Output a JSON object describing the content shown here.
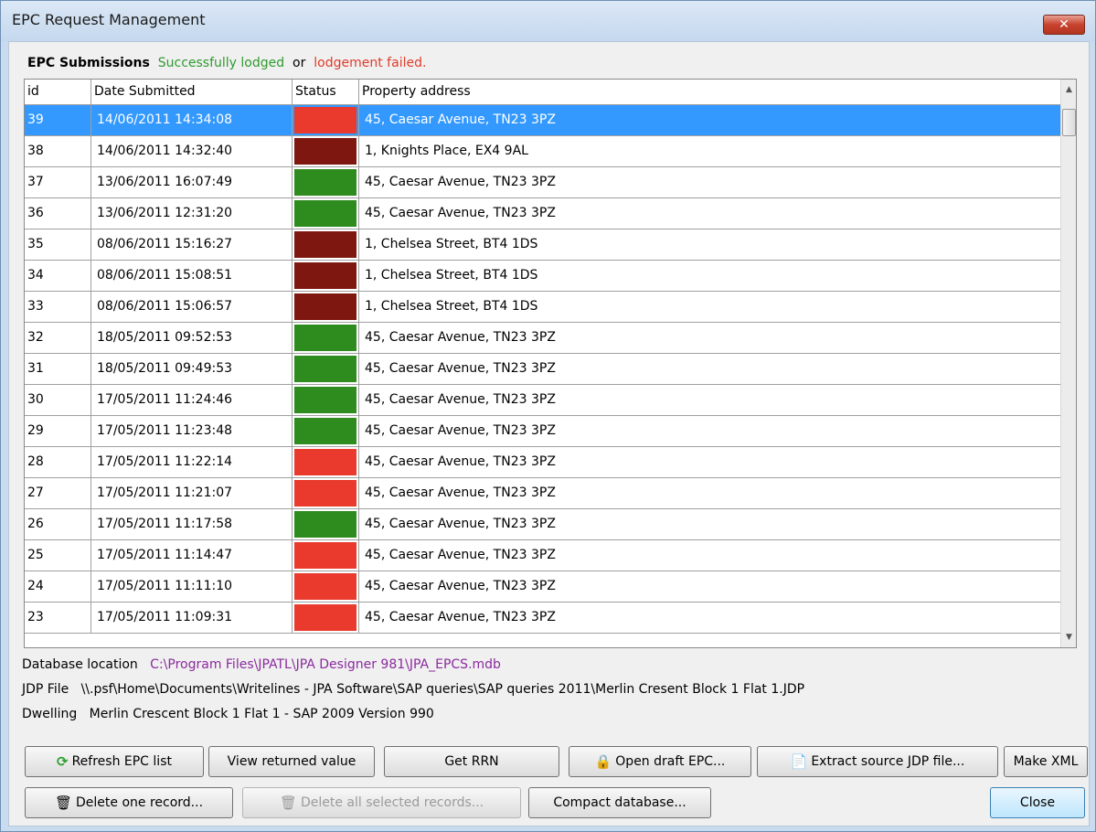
{
  "window": {
    "title": "EPC Request Management",
    "close_glyph": "✕"
  },
  "legend": {
    "prefix": "EPC Submissions",
    "ok_text": "Successfully lodged",
    "or_text": "or",
    "fail_text": "lodgement failed."
  },
  "table": {
    "columns": [
      "id",
      "Date Submitted",
      "Status",
      "Property address"
    ],
    "status_colors": {
      "red": "#ea3a2d",
      "dark_red": "#7e1710",
      "green": "#2e8b1e"
    },
    "rows": [
      {
        "id": "39",
        "date": "14/06/2011 14:34:08",
        "status": "red",
        "address": "45, Caesar Avenue, TN23 3PZ",
        "selected": true
      },
      {
        "id": "38",
        "date": "14/06/2011 14:32:40",
        "status": "dark_red",
        "address": "1, Knights Place, EX4 9AL"
      },
      {
        "id": "37",
        "date": "13/06/2011 16:07:49",
        "status": "green",
        "address": "45, Caesar Avenue, TN23 3PZ"
      },
      {
        "id": "36",
        "date": "13/06/2011 12:31:20",
        "status": "green",
        "address": "45, Caesar Avenue, TN23 3PZ"
      },
      {
        "id": "35",
        "date": "08/06/2011 15:16:27",
        "status": "dark_red",
        "address": "1, Chelsea Street, BT4 1DS"
      },
      {
        "id": "34",
        "date": "08/06/2011 15:08:51",
        "status": "dark_red",
        "address": "1, Chelsea Street, BT4 1DS"
      },
      {
        "id": "33",
        "date": "08/06/2011 15:06:57",
        "status": "dark_red",
        "address": "1, Chelsea Street, BT4 1DS"
      },
      {
        "id": "32",
        "date": "18/05/2011 09:52:53",
        "status": "green",
        "address": "45, Caesar Avenue, TN23 3PZ"
      },
      {
        "id": "31",
        "date": "18/05/2011 09:49:53",
        "status": "green",
        "address": "45, Caesar Avenue, TN23 3PZ"
      },
      {
        "id": "30",
        "date": "17/05/2011 11:24:46",
        "status": "green",
        "address": "45, Caesar Avenue, TN23 3PZ"
      },
      {
        "id": "29",
        "date": "17/05/2011 11:23:48",
        "status": "green",
        "address": "45, Caesar Avenue, TN23 3PZ"
      },
      {
        "id": "28",
        "date": "17/05/2011 11:22:14",
        "status": "red",
        "address": "45, Caesar Avenue, TN23 3PZ"
      },
      {
        "id": "27",
        "date": "17/05/2011 11:21:07",
        "status": "red",
        "address": "45, Caesar Avenue, TN23 3PZ"
      },
      {
        "id": "26",
        "date": "17/05/2011 11:17:58",
        "status": "green",
        "address": "45, Caesar Avenue, TN23 3PZ"
      },
      {
        "id": "25",
        "date": "17/05/2011 11:14:47",
        "status": "red",
        "address": "45, Caesar Avenue, TN23 3PZ"
      },
      {
        "id": "24",
        "date": "17/05/2011 11:11:10",
        "status": "red",
        "address": "45, Caesar Avenue, TN23 3PZ"
      },
      {
        "id": "23",
        "date": "17/05/2011 11:09:31",
        "status": "red",
        "address": "45, Caesar Avenue, TN23 3PZ"
      }
    ]
  },
  "info": {
    "db_label": "Database location",
    "db_value": "C:\\Program Files\\JPATL\\JPA Designer 981\\JPA_EPCS.mdb",
    "jdp_label": "JDP File",
    "jdp_value": "\\\\.psf\\Home\\Documents\\Writelines - JPA Software\\SAP queries\\SAP queries 2011\\Merlin Cresent Block 1 Flat 1.JDP",
    "dwelling_label": "Dwelling",
    "dwelling_value": "Merlin Crescent Block 1 Flat 1 - SAP 2009 Version 990"
  },
  "buttons": {
    "refresh": "Refresh EPC list",
    "view_returned": "View returned value",
    "get_rrn": "Get RRN",
    "open_draft": "Open draft EPC...",
    "extract_source": "Extract source JDP file...",
    "make_xml": "Make XML",
    "delete_one": "Delete one record...",
    "delete_all": "Delete all selected records...",
    "compact": "Compact database...",
    "close": "Close"
  },
  "icons": {
    "refresh": "refresh-icon",
    "lock": "lock-icon",
    "extract": "document-extract-icon",
    "trash": "trash-icon",
    "scroll_up": "▲",
    "scroll_down": "▼"
  }
}
